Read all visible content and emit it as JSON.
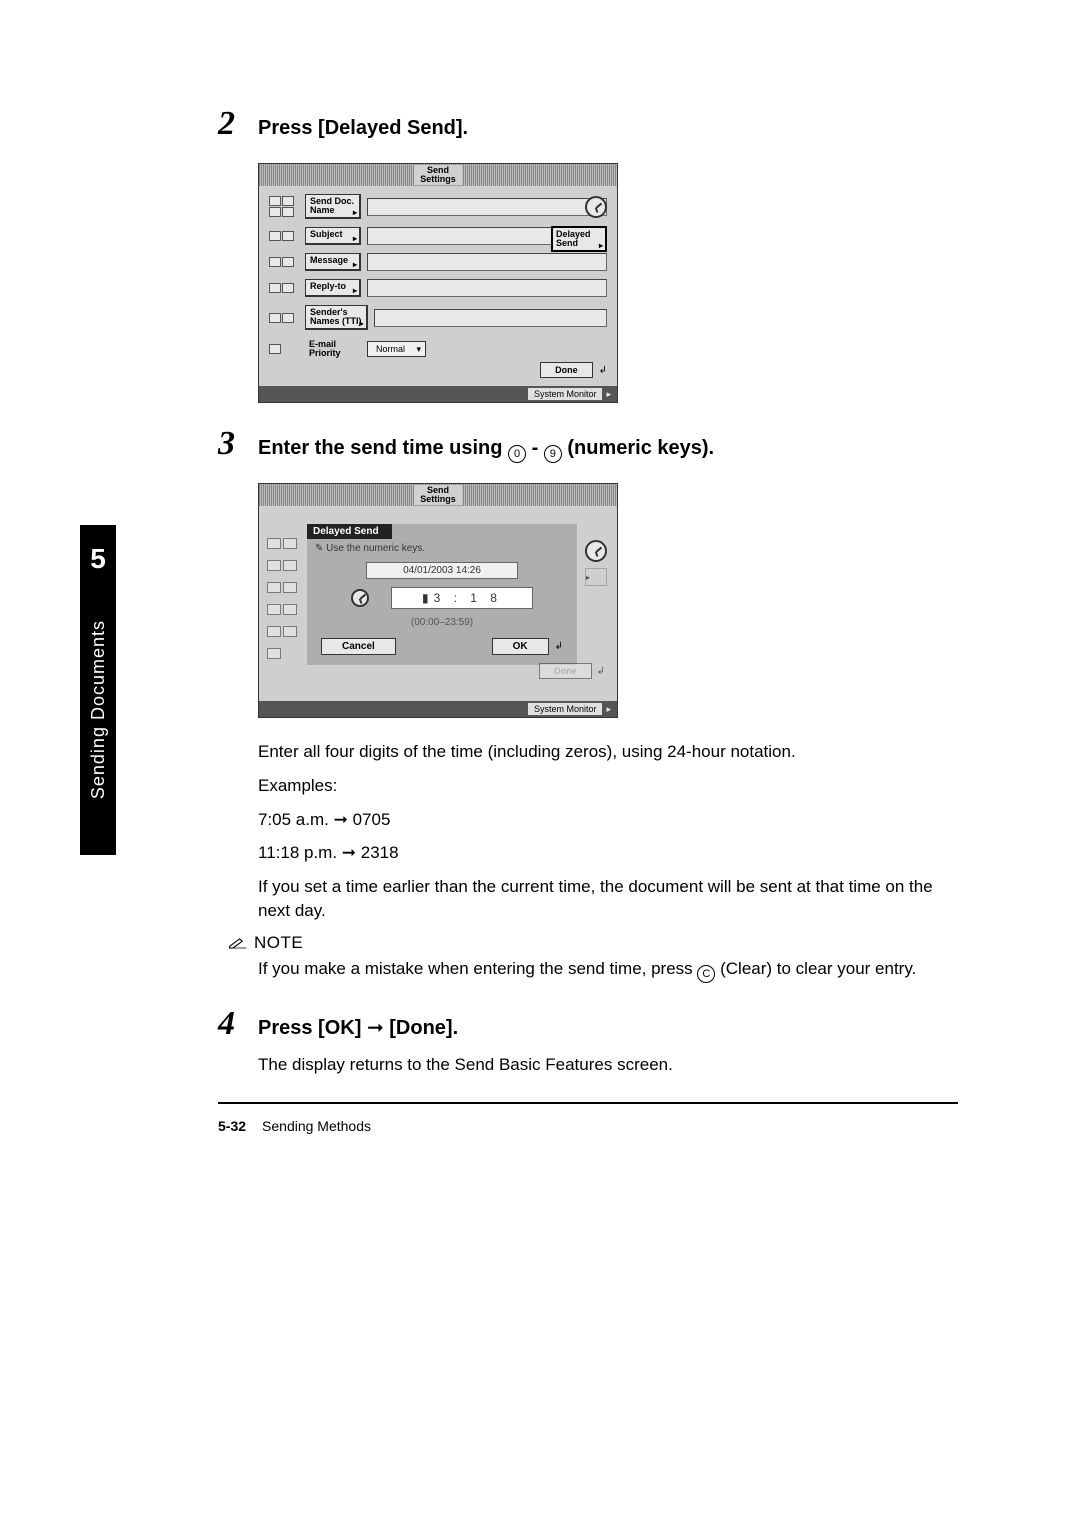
{
  "sidebar": {
    "chapter": "5",
    "title": "Sending Documents"
  },
  "step2": {
    "num": "2",
    "title": "Press [Delayed Send].",
    "header": "Send\nSettings",
    "rows": {
      "doc": "Send Doc.\nName",
      "subject": "Subject",
      "message": "Message",
      "replyto": "Reply-to",
      "sender": "Sender's\nNames (TTI)",
      "epriority": "E-mail\nPriority",
      "normal": "Normal"
    },
    "delayed": "Delayed\nSend",
    "done": "Done",
    "sysmon": "System Monitor"
  },
  "step3": {
    "num": "3",
    "title_a": "Enter the send time using ",
    "title_b": " - ",
    "title_c": " (numeric keys).",
    "key0": "0",
    "key9": "9",
    "header": "Send\nSettings",
    "modal_title": "Delayed Send",
    "hint": "Use the numeric keys.",
    "date": "04/01/2003 14:26",
    "time": "3 : 1 8",
    "range": "(00:00–23:59)",
    "cancel": "Cancel",
    "ok": "OK",
    "done": "Done",
    "sysmon": "System Monitor",
    "p1": "Enter all four digits of the time (including zeros), using 24-hour notation.",
    "p2": "Examples:",
    "p3a": "7:05 a.m. ",
    "p3b": " 0705",
    "p4a": "11:18 p.m. ",
    "p4b": " 2318",
    "p5": "If you set a time earlier than the current time, the document will be sent at that time on the next day."
  },
  "note": {
    "label": "NOTE",
    "text_a": "If you make a mistake when entering the send time, press ",
    "text_b": " (Clear) to clear your entry.",
    "keyC": "C"
  },
  "step4": {
    "num": "4",
    "title_a": "Press [OK] ",
    "title_b": " [Done].",
    "p1": "The display returns to the Send Basic Features screen."
  },
  "footer": {
    "page": "5-32",
    "section": "Sending Methods"
  }
}
